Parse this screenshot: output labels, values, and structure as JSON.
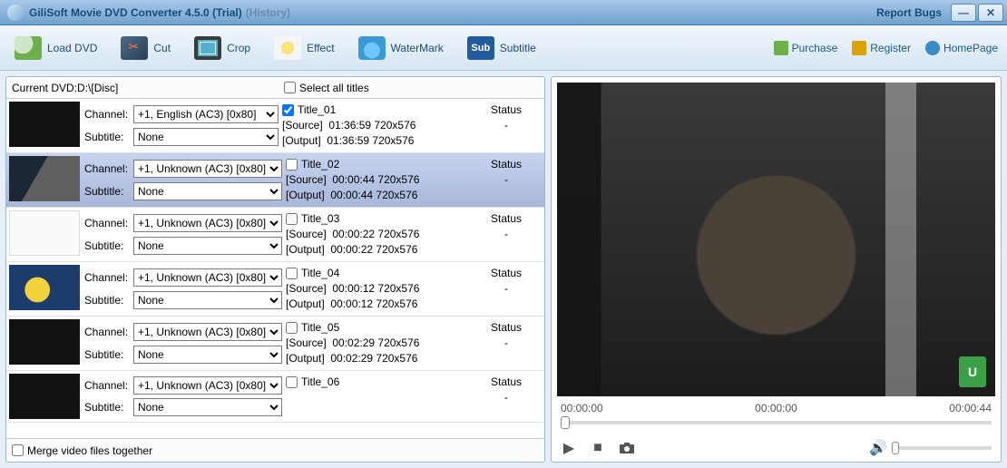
{
  "window": {
    "title": "GiliSoft Movie DVD Converter 4.5.0 (Trial)",
    "history": "(History)",
    "report": "Report Bugs"
  },
  "toolbar": {
    "load": "Load DVD",
    "cut": "Cut",
    "crop": "Crop",
    "effect": "Effect",
    "watermark": "WaterMark",
    "subtitle": "Subtitle"
  },
  "links": {
    "purchase": "Purchase",
    "register": "Register",
    "homepage": "HomePage"
  },
  "left": {
    "current_label": "Current DVD:",
    "current_value": "D:\\[Disc]",
    "select_all": "Select all titles",
    "channel_label": "Channel:",
    "subtitle_label": "Subtitle:",
    "source_label": "[Source]",
    "output_label": "[Output]",
    "status_label": "Status",
    "status_val": "-",
    "merge": "Merge video files together",
    "rows": [
      {
        "title": "Title_01",
        "channel": "+1, English (AC3) [0x80]",
        "subtitle": "None",
        "checked": true,
        "src": "01:36:59  720x576",
        "out": "01:36:59  720x576",
        "thumb": "black"
      },
      {
        "title": "Title_02",
        "channel": "+1, Unknown (AC3) [0x80]",
        "subtitle": "None",
        "checked": false,
        "src": "00:00:44  720x576",
        "out": "00:00:44  720x576",
        "thumb": "scene1",
        "selected": true
      },
      {
        "title": "Title_03",
        "channel": "+1, Unknown (AC3) [0x80]",
        "subtitle": "None",
        "checked": false,
        "src": "00:00:22  720x576",
        "out": "00:00:22  720x576",
        "thumb": "white"
      },
      {
        "title": "Title_04",
        "channel": "+1, Unknown (AC3) [0x80]",
        "subtitle": "None",
        "checked": false,
        "src": "00:00:12  720x576",
        "out": "00:00:12  720x576",
        "thumb": "scene2"
      },
      {
        "title": "Title_05",
        "channel": "+1, Unknown (AC3) [0x80]",
        "subtitle": "None",
        "checked": false,
        "src": "00:02:29  720x576",
        "out": "00:02:29  720x576",
        "thumb": "black"
      },
      {
        "title": "Title_06",
        "channel": "+1, Unknown (AC3) [0x80]",
        "subtitle": "None",
        "checked": false,
        "src": "",
        "out": "",
        "thumb": "black"
      }
    ]
  },
  "player": {
    "t0": "00:00:00",
    "t1": "00:00:00",
    "t2": "00:00:44"
  }
}
